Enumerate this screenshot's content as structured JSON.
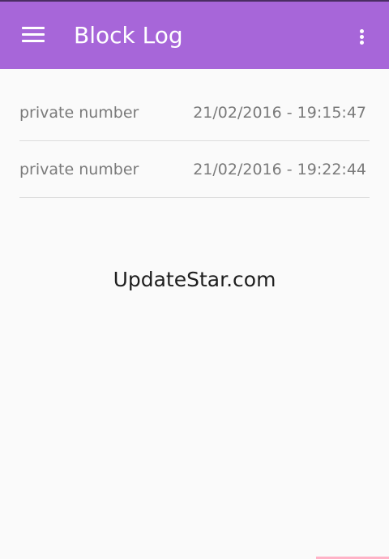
{
  "app_bar": {
    "title": "Block Log",
    "menu_icon": "hamburger-menu-icon",
    "overflow_icon": "more-vertical-icon",
    "color": "#a766d9"
  },
  "block_log": {
    "entries": [
      {
        "caller": "private number",
        "timestamp": "21/02/2016 - 19:15:47"
      },
      {
        "caller": "private number",
        "timestamp": "21/02/2016 - 19:22:44"
      }
    ]
  },
  "watermark": "UpdateStar.com"
}
